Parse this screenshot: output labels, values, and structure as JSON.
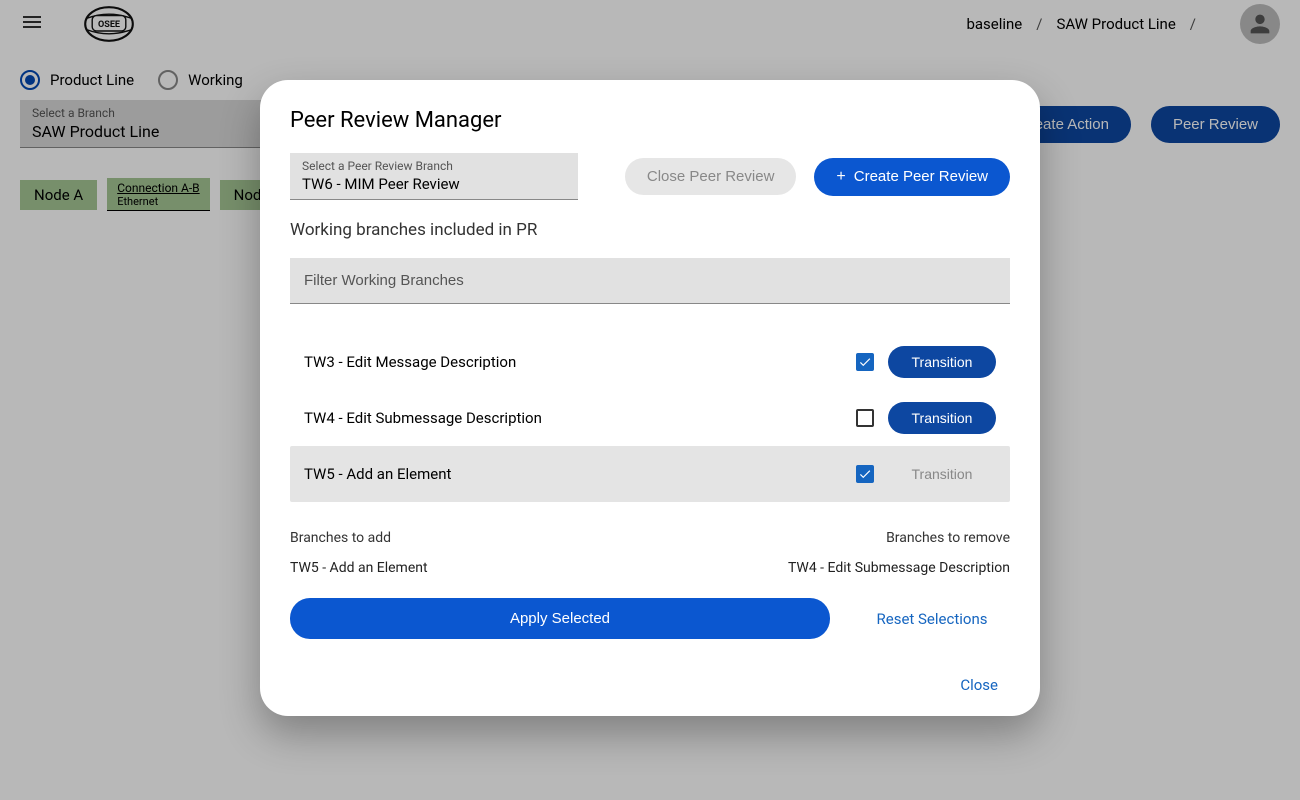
{
  "header": {
    "breadcrumb": [
      "baseline",
      "SAW Product Line",
      ""
    ]
  },
  "branch_type": {
    "options": [
      "Product Line",
      "Working"
    ],
    "selected": "Product Line"
  },
  "branch_selector": {
    "label": "Select a Branch",
    "value": "SAW Product Line"
  },
  "toolbar": {
    "create_action": "Create Action",
    "peer_review": "Peer Review"
  },
  "graph": {
    "nodes": [
      "Node A",
      "Node B"
    ],
    "connection": {
      "name": "Connection A-B",
      "type": "Ethernet"
    }
  },
  "dialog": {
    "title": "Peer Review Manager",
    "pr_branch": {
      "label": "Select a Peer Review Branch",
      "value": "TW6 - MIM Peer Review"
    },
    "close_pr_label": "Close Peer Review",
    "create_pr_label": "Create Peer Review",
    "section_label": "Working branches included in PR",
    "filter_placeholder": "Filter Working Branches",
    "branches": [
      {
        "name": "TW3 - Edit Message Description",
        "checked": true,
        "transition_enabled": true,
        "highlight": false
      },
      {
        "name": "TW4 - Edit Submessage Description",
        "checked": false,
        "transition_enabled": true,
        "highlight": false
      },
      {
        "name": "TW5 - Add an Element",
        "checked": true,
        "transition_enabled": false,
        "highlight": true
      }
    ],
    "transition_label": "Transition",
    "summary_add_label": "Branches to add",
    "summary_remove_label": "Branches to remove",
    "summary_add_value": "TW5 - Add an Element",
    "summary_remove_value": "TW4 - Edit Submessage Description",
    "apply_label": "Apply Selected",
    "reset_label": "Reset Selections",
    "close_label": "Close"
  }
}
